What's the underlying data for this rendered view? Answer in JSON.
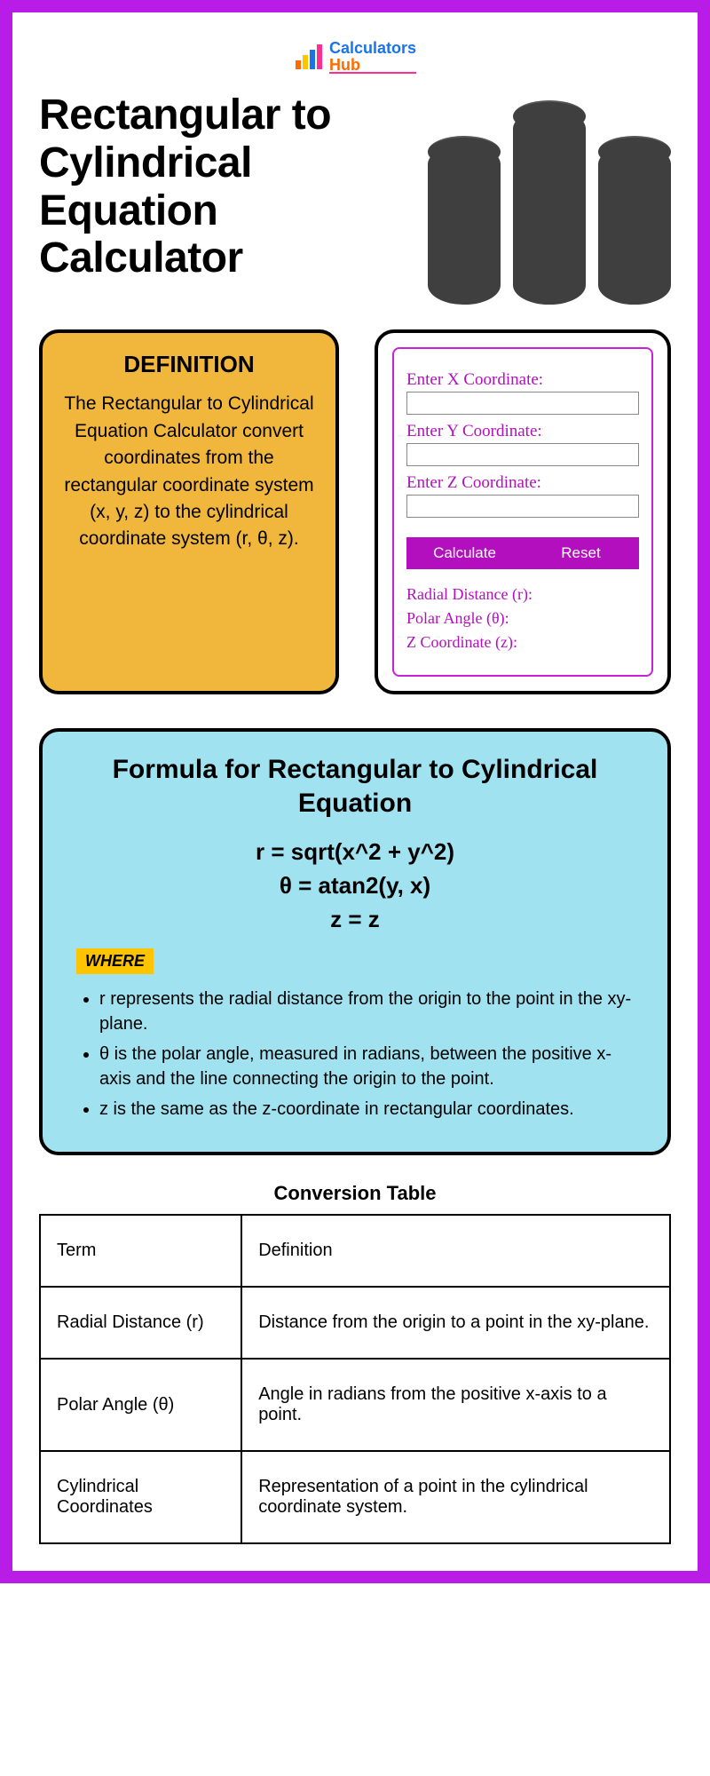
{
  "logo": {
    "line1": "Calculators",
    "line2": "Hub"
  },
  "hero_title": "Rectangular to Cylindrical Equation Calculator",
  "definition": {
    "heading": "DEFINITION",
    "body": "The Rectangular to Cylindrical Equation Calculator convert coordinates from the rectangular coordinate system (x, y, z) to the cylindrical coordinate system (r, θ, z)."
  },
  "calculator": {
    "x_label": "Enter X Coordinate:",
    "y_label": "Enter Y Coordinate:",
    "z_label": "Enter Z Coordinate:",
    "calc_btn": "Calculate",
    "reset_btn": "Reset",
    "r_out": "Radial Distance (r):",
    "theta_out": "Polar Angle (θ):",
    "z_out": "Z Coordinate (z):"
  },
  "formula": {
    "heading": "Formula for Rectangular to Cylindrical Equation",
    "eq1": "r = sqrt(x^2 + y^2)",
    "eq2": "θ = atan2(y, x)",
    "eq3": "z = z",
    "where_label": "WHERE",
    "bullets": [
      "r represents the radial distance from the origin to the point in the xy-plane.",
      "θ is the polar angle, measured in radians, between the positive x-axis and the line connecting the origin to the point.",
      "z is the same as the z-coordinate in rectangular coordinates."
    ]
  },
  "table": {
    "title": "Conversion Table",
    "rows": [
      {
        "term": "Term",
        "def": "Definition"
      },
      {
        "term": "Radial Distance (r)",
        "def": "Distance from the origin to a point in the xy-plane."
      },
      {
        "term": "Polar Angle (θ)",
        "def": "Angle in radians from the positive x-axis to a point."
      },
      {
        "term": "Cylindrical Coordinates",
        "def": "Representation of a point in the cylindrical coordinate system."
      }
    ]
  }
}
